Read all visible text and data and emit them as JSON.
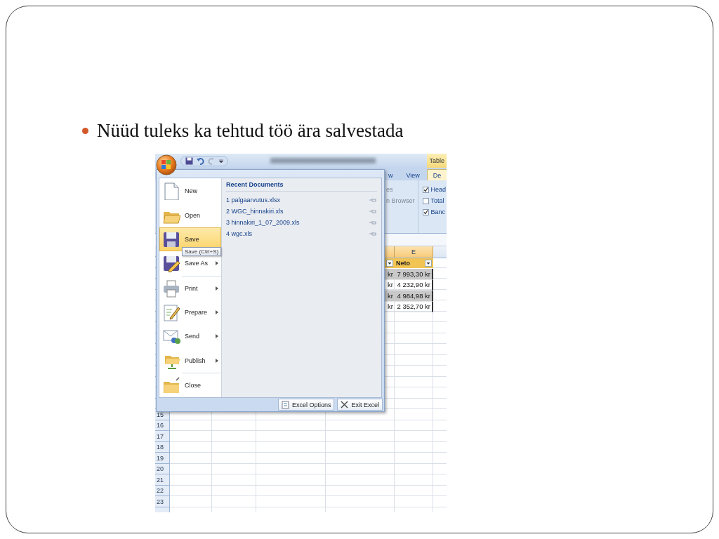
{
  "slide": {
    "bullet": "Nüüd tuleks ka tehtud töö ära salvestada"
  },
  "excel": {
    "contextual_tab": "Table",
    "ribbon_tabs": [
      {
        "label": "w",
        "selected": false
      },
      {
        "label": "View",
        "selected": false
      },
      {
        "label": "De",
        "selected": true
      }
    ],
    "ribbon_commands": [
      {
        "label": "es",
        "disabled": true
      },
      {
        "label": "n Browser",
        "disabled": true
      }
    ],
    "ribbon_options": [
      {
        "label": "Head",
        "checked": true
      },
      {
        "label": "Total",
        "checked": false
      },
      {
        "label": "Banc",
        "checked": true
      }
    ],
    "column_headers": [
      {
        "kind": "blank",
        "selected": true
      },
      {
        "kind": "label",
        "label": "E",
        "selected": true
      }
    ],
    "header_cells": [
      {
        "kind": "filter"
      },
      {
        "kind": "label",
        "text": "Neto"
      }
    ],
    "data_rows": [
      {
        "cells": [
          "kr",
          "7 993,30 kr"
        ],
        "shaded": true
      },
      {
        "cells": [
          "kr",
          "4 232,90 kr"
        ],
        "shaded": false
      },
      {
        "cells": [
          "kr",
          "4 984,98 kr"
        ],
        "shaded": true
      },
      {
        "cells": [
          "kr",
          "2 352,70 kr"
        ],
        "shaded": false
      }
    ],
    "row_numbers": [
      "15",
      "16",
      "17",
      "18",
      "19",
      "20",
      "21",
      "22",
      "23"
    ],
    "menu": {
      "items": [
        {
          "kind": "new",
          "label": "New",
          "selected": false,
          "submenu": false
        },
        {
          "kind": "open",
          "label": "Open",
          "selected": false,
          "submenu": false
        },
        {
          "kind": "save",
          "label": "Save",
          "selected": true,
          "submenu": false
        },
        {
          "kind": "saveas",
          "label": "Save As",
          "selected": false,
          "submenu": true
        },
        {
          "kind": "print",
          "label": "Print",
          "selected": false,
          "submenu": true
        },
        {
          "kind": "prepare",
          "label": "Prepare",
          "selected": false,
          "submenu": true
        },
        {
          "kind": "send",
          "label": "Send",
          "selected": false,
          "submenu": true
        },
        {
          "kind": "publish",
          "label": "Publish",
          "selected": false,
          "submenu": true
        },
        {
          "kind": "close",
          "label": "Close",
          "selected": false,
          "submenu": false
        }
      ],
      "recent_title": "Recent Documents",
      "recent": [
        {
          "number": "1",
          "name": "palgaarvutus.xlsx"
        },
        {
          "number": "2",
          "name": "WGC_hinnakiri.xls"
        },
        {
          "number": "3",
          "name": "hinnakiri_1_07_2009.xls"
        },
        {
          "number": "4",
          "name": "wgc.xls"
        }
      ],
      "buttons": [
        {
          "kind": "options",
          "label": "Excel Options"
        },
        {
          "kind": "exit",
          "label": "Exit Excel"
        }
      ],
      "tooltip": "Save (Ctrl+S)"
    }
  }
}
